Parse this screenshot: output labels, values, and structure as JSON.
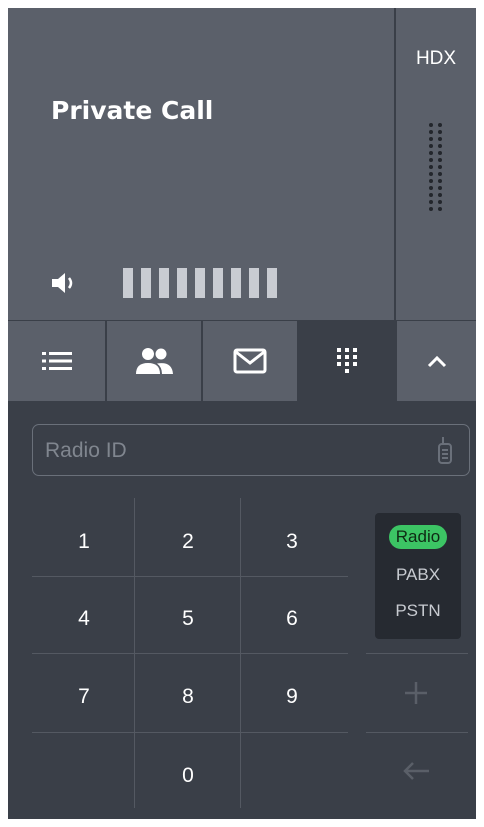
{
  "call": {
    "title": "Private Call",
    "volume_level": 9,
    "volume_max": 9
  },
  "side": {
    "label": "HDX"
  },
  "tabs": [
    {
      "name": "list",
      "icon": "list-icon",
      "active": false
    },
    {
      "name": "contacts",
      "icon": "contacts-icon",
      "active": false
    },
    {
      "name": "messages",
      "icon": "message-icon",
      "active": false
    },
    {
      "name": "dialpad",
      "icon": "dialpad-icon",
      "active": true
    },
    {
      "name": "collapse",
      "icon": "chevron-up-icon",
      "active": false
    }
  ],
  "search": {
    "placeholder": "Radio ID",
    "value": ""
  },
  "keypad": {
    "keys": [
      "1",
      "2",
      "3",
      "4",
      "5",
      "6",
      "7",
      "8",
      "9",
      "0"
    ]
  },
  "mode": {
    "options": [
      "Radio",
      "PABX",
      "PSTN"
    ],
    "selected": "Radio"
  },
  "actions": {
    "add_icon": "plus-icon",
    "backspace_icon": "backspace-arrow-icon"
  },
  "colors": {
    "panel": "#5b606a",
    "background": "#3a3f48",
    "selected_mode": "#3cc464"
  }
}
